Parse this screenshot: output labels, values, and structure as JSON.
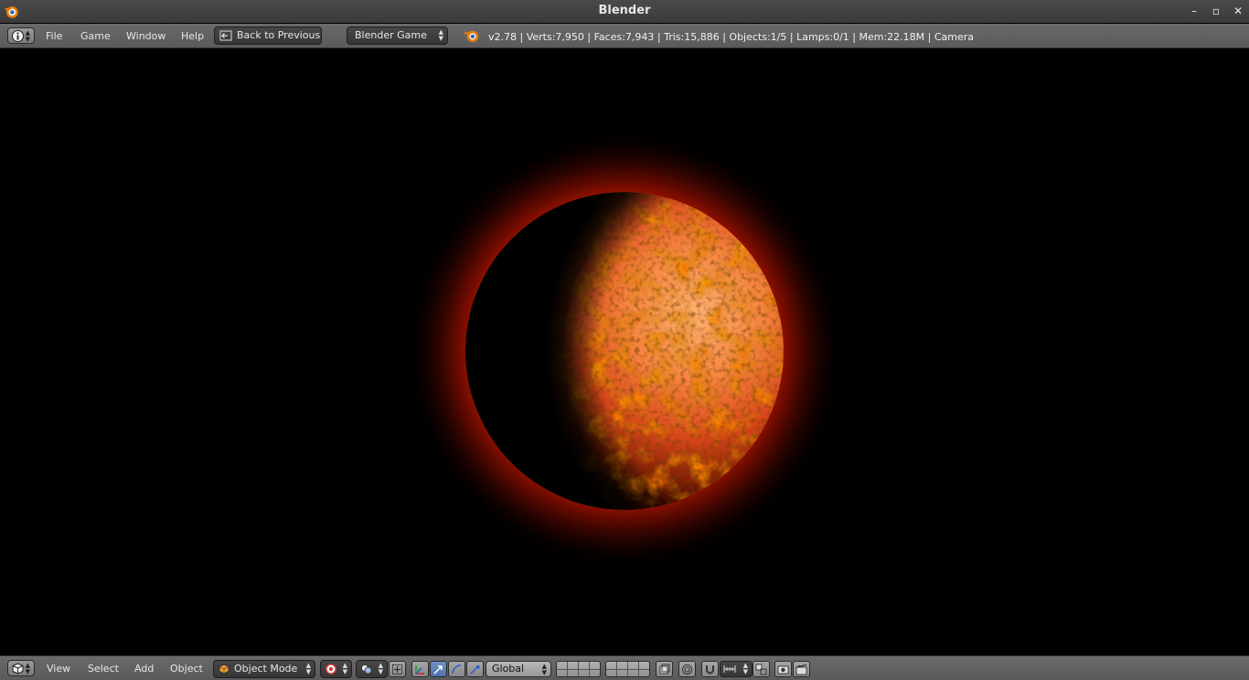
{
  "window": {
    "title": "Blender",
    "minimize_symbol": "–",
    "maximize_symbol": "▫",
    "close_symbol": "✕"
  },
  "info_header": {
    "editor_type_icon": "info-icon",
    "menus": [
      "File",
      "Game",
      "Window",
      "Help"
    ],
    "back_button_label": "Back to Previous",
    "engine_select_value": "Blender Game",
    "status_text": "v2.78 | Verts:7,950 | Faces:7,943 | Tris:15,886 | Objects:1/5 | Lamps:0/1 | Mem:22.18M | Camera"
  },
  "viewport_header": {
    "editor_type_icon": "3d-view-cube-icon",
    "menus": [
      "View",
      "Select",
      "Add",
      "Object"
    ],
    "mode_select_value": "Object Mode",
    "orientation_select_value": "Global"
  },
  "colors": {
    "planet_bright": "#ff9a4a",
    "planet_lava": "#e02a0a",
    "glow": "#b01400"
  }
}
